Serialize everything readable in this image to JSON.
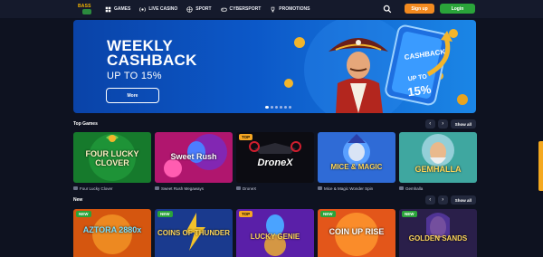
{
  "header": {
    "logo_text": "BASS",
    "nav": [
      {
        "label": "GAMES",
        "icon": "games-icon"
      },
      {
        "label": "LIVE CASINO",
        "icon": "live-icon"
      },
      {
        "label": "SPORT",
        "icon": "ball-icon"
      },
      {
        "label": "CYBERSPORT",
        "icon": "gamepad-icon"
      },
      {
        "label": "PROMOTIONS",
        "icon": "trophy-icon"
      }
    ],
    "signup_label": "Sign up",
    "login_label": "Login"
  },
  "hero": {
    "title_line1": "WEEKLY",
    "title_line2": "CASHBACK",
    "subtitle": "UP TO 15%",
    "button_label": "More",
    "phone_text1": "CASHBACK",
    "phone_text2": "UP TO",
    "phone_text3": "15%",
    "slides": 6,
    "active_slide": 1
  },
  "top_games": {
    "title": "Top Games",
    "prev": "‹",
    "next": "›",
    "show_all": "Show all",
    "items": [
      {
        "name": "Four Lucky Clover",
        "art": "FOUR LUCKY CLOVER",
        "tag": ""
      },
      {
        "name": "Sweet Rush Megaways",
        "art": "Sweet Rush",
        "tag": ""
      },
      {
        "name": "DroneX",
        "art": "DroneX",
        "tag": "TOP"
      },
      {
        "name": "Mice & Magic Wonder Spin",
        "art": "MICE & MAGIC",
        "tag": ""
      },
      {
        "name": "Gemhalla",
        "art": "GEMHALLA",
        "tag": ""
      }
    ]
  },
  "new_games": {
    "title": "New",
    "prev": "‹",
    "next": "›",
    "show_all": "Show all",
    "items": [
      {
        "art": "AZTORA 2880x",
        "tag": "NEW"
      },
      {
        "art": "COINS OF THUNDER",
        "tag": "NEW"
      },
      {
        "art": "LUCKY GENIE",
        "tag": "TOP"
      },
      {
        "art": "COIN UP RISE",
        "tag": "NEW"
      },
      {
        "art": "GOLDEN SANDS",
        "tag": "NEW"
      }
    ]
  }
}
